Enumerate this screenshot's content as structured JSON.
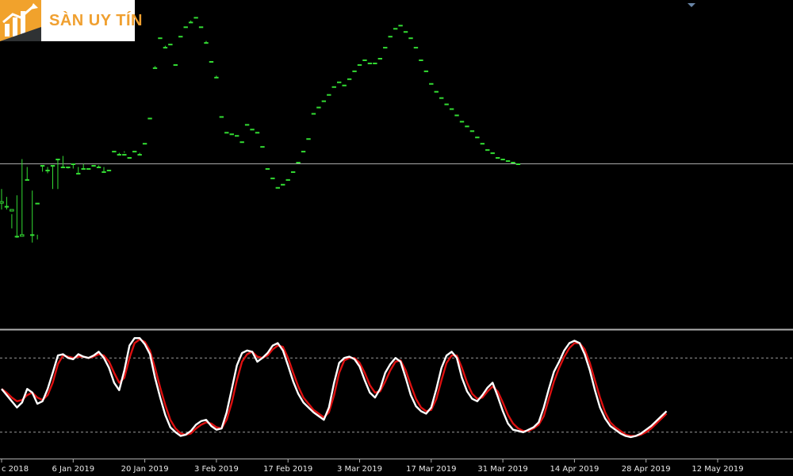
{
  "logo": {
    "brand_text": "SÀN UY TÍN"
  },
  "chart_data": [
    {
      "type": "candlestick",
      "panel": "price",
      "colors": {
        "candle": "#33dd33",
        "background": "#000000",
        "hline": "#aaaaaa"
      },
      "hline": 0.0,
      "ylim": [
        -100,
        100
      ],
      "ohlc": [
        [
          -16,
          -24,
          -25,
          -29
        ],
        [
          -21,
          -27,
          -27,
          -29
        ],
        [
          -32,
          -29,
          -30,
          -41
        ],
        [
          -20,
          -46,
          -46,
          -47
        ],
        [
          3,
          -46,
          -45,
          -46
        ],
        [
          -2,
          -10,
          -10,
          -10
        ],
        [
          -17,
          -45,
          -45,
          -50
        ],
        [
          -48,
          -25,
          -25,
          -45
        ],
        [
          -5,
          -1,
          -1,
          -1
        ],
        [
          -2,
          -4,
          -4,
          -6
        ],
        [
          -16,
          -1,
          -1,
          -1
        ],
        [
          -16,
          3,
          3,
          3
        ],
        [
          5,
          -2,
          -2,
          -2
        ],
        [
          -2,
          -2,
          -2,
          -3
        ],
        [
          -3,
          0,
          0,
          0
        ],
        [
          -2,
          -6,
          -6,
          -6
        ],
        [
          0,
          -3,
          -3,
          -3
        ],
        [
          -3,
          -3,
          -3,
          -3
        ],
        [
          -1,
          -1,
          -1,
          -1
        ],
        [
          -1,
          -2,
          -2,
          -2
        ],
        [
          -2,
          -5,
          -5,
          -5
        ],
        [
          -4,
          -4,
          -4,
          -4
        ],
        [
          8,
          8,
          8,
          8
        ],
        [
          7,
          6,
          6,
          6
        ],
        [
          8,
          6,
          6,
          7
        ],
        [
          4,
          4,
          4,
          4
        ],
        [
          8,
          8,
          8,
          8
        ],
        [
          7,
          6,
          6,
          6
        ],
        [
          13,
          13,
          13,
          13
        ],
        [
          29,
          29,
          29,
          29
        ],
        [
          62,
          61,
          61,
          61
        ],
        [
          81,
          80,
          80,
          81
        ],
        [
          75,
          74,
          74,
          74
        ],
        [
          78,
          76,
          76,
          78
        ],
        [
          64,
          63,
          63,
          64
        ],
        [
          81,
          81,
          81,
          81
        ],
        [
          87,
          87,
          87,
          87
        ],
        [
          91,
          90,
          90,
          90
        ],
        [
          93,
          93,
          93,
          93
        ],
        [
          87,
          87,
          87,
          87
        ],
        [
          78,
          77,
          77,
          77
        ],
        [
          65,
          65,
          65,
          65
        ],
        [
          56,
          55,
          55,
          55
        ],
        [
          30,
          30,
          30,
          30
        ],
        [
          20,
          20,
          20,
          20
        ],
        [
          19,
          19,
          19,
          19
        ],
        [
          18,
          18,
          18,
          18
        ],
        [
          14,
          14,
          14,
          14
        ],
        [
          25,
          25,
          25,
          25
        ],
        [
          22,
          22,
          22,
          22
        ],
        [
          20,
          20,
          20,
          20
        ],
        [
          11,
          11,
          11,
          11
        ],
        [
          -3,
          -3,
          -3,
          -3
        ],
        [
          -9,
          -9,
          -9,
          -9
        ],
        [
          -15,
          -15,
          -15,
          -15
        ],
        [
          -13,
          -13,
          -13,
          -13
        ],
        [
          -10,
          -10,
          -10,
          -10
        ],
        [
          -5,
          -5,
          -5,
          -5
        ],
        [
          1,
          1,
          1,
          1
        ],
        [
          8,
          8,
          8,
          8
        ],
        [
          16,
          16,
          16,
          16
        ],
        [
          32,
          32,
          32,
          32
        ],
        [
          36,
          36,
          36,
          36
        ],
        [
          40,
          40,
          40,
          40
        ],
        [
          44,
          44,
          44,
          44
        ],
        [
          49,
          49,
          49,
          49
        ],
        [
          52,
          52,
          52,
          52
        ],
        [
          50,
          50,
          50,
          50
        ],
        [
          54,
          54,
          54,
          54
        ],
        [
          59,
          59,
          59,
          59
        ],
        [
          63,
          63,
          63,
          63
        ],
        [
          66,
          66,
          66,
          66
        ],
        [
          64,
          64,
          64,
          64
        ],
        [
          64,
          64,
          64,
          64
        ],
        [
          67,
          67,
          67,
          67
        ],
        [
          74,
          74,
          74,
          74
        ],
        [
          81,
          81,
          81,
          81
        ],
        [
          86,
          86,
          86,
          86
        ],
        [
          88,
          88,
          88,
          88
        ],
        [
          84,
          84,
          84,
          84
        ],
        [
          80,
          80,
          80,
          80
        ],
        [
          74,
          74,
          74,
          74
        ],
        [
          66,
          66,
          66,
          66
        ],
        [
          59,
          59,
          59,
          59
        ],
        [
          51,
          51,
          51,
          51
        ],
        [
          46,
          46,
          46,
          46
        ],
        [
          42,
          42,
          42,
          42
        ],
        [
          38,
          38,
          38,
          38
        ],
        [
          35,
          35,
          35,
          35
        ],
        [
          31,
          31,
          31,
          31
        ],
        [
          27,
          27,
          27,
          27
        ],
        [
          24,
          24,
          24,
          24
        ],
        [
          21,
          21,
          21,
          21
        ],
        [
          17,
          17,
          17,
          17
        ],
        [
          13,
          13,
          13,
          13
        ],
        [
          9,
          9,
          9,
          9
        ],
        [
          7,
          7,
          7,
          7
        ],
        [
          4,
          4,
          4,
          4
        ],
        [
          3,
          3,
          3,
          3
        ],
        [
          2,
          2,
          2,
          2
        ],
        [
          1,
          1,
          1,
          1
        ],
        [
          0,
          0,
          0,
          0
        ]
      ]
    },
    {
      "type": "line",
      "panel": "oscillator",
      "ylim": [
        0,
        100
      ],
      "levels": [
        80,
        20
      ],
      "x_tick_labels": [
        "c 2018",
        "6 Jan 2019",
        "20 Jan 2019",
        "3 Feb 2019",
        "17 Feb 2019",
        "3 Mar 2019",
        "17 Mar 2019",
        "31 Mar 2019",
        "14 Apr 2019",
        "28 Apr 2019",
        "12 May 2019"
      ],
      "x_tick_positions": [
        0,
        14,
        28,
        42,
        56,
        70,
        84,
        98,
        112,
        126,
        140
      ],
      "series": [
        {
          "color": "#ffffff",
          "values": [
            55,
            50,
            45,
            40,
            44,
            55,
            52,
            43,
            45,
            55,
            68,
            82,
            83,
            80,
            79,
            83,
            81,
            80,
            82,
            85,
            80,
            72,
            60,
            54,
            70,
            90,
            96,
            96,
            91,
            83,
            64,
            48,
            34,
            24,
            20,
            17,
            18,
            21,
            26,
            29,
            30,
            25,
            22,
            23,
            36,
            55,
            74,
            84,
            86,
            85,
            77,
            80,
            84,
            90,
            92,
            86,
            74,
            61,
            51,
            44,
            40,
            36,
            33,
            30,
            40,
            60,
            76,
            80,
            81,
            79,
            73,
            62,
            52,
            48,
            55,
            68,
            75,
            80,
            77,
            64,
            50,
            41,
            37,
            35,
            40,
            55,
            72,
            82,
            85,
            80,
            64,
            53,
            47,
            45,
            50,
            56,
            60,
            49,
            37,
            27,
            22,
            21,
            20,
            22,
            24,
            28,
            40,
            55,
            69,
            77,
            86,
            92,
            94,
            92,
            83,
            70,
            54,
            40,
            31,
            25,
            22,
            19,
            17,
            16,
            17,
            19,
            22,
            25,
            29,
            33,
            37
          ]
        },
        {
          "color": "#dd1111",
          "values": [
            55,
            52,
            48,
            45,
            46,
            50,
            52,
            48,
            46,
            50,
            60,
            75,
            82,
            81,
            80,
            81,
            81,
            80,
            81,
            83,
            82,
            77,
            68,
            60,
            64,
            80,
            92,
            95,
            93,
            86,
            72,
            56,
            42,
            30,
            23,
            19,
            18,
            19,
            23,
            26,
            28,
            27,
            24,
            23,
            30,
            44,
            62,
            77,
            83,
            85,
            81,
            80,
            82,
            87,
            90,
            89,
            80,
            68,
            57,
            48,
            43,
            38,
            35,
            32,
            36,
            50,
            68,
            78,
            80,
            80,
            76,
            68,
            58,
            52,
            53,
            61,
            70,
            77,
            78,
            70,
            58,
            47,
            40,
            37,
            38,
            47,
            62,
            76,
            82,
            82,
            72,
            60,
            51,
            47,
            48,
            53,
            57,
            53,
            44,
            34,
            27,
            23,
            21,
            21,
            23,
            26,
            33,
            47,
            61,
            72,
            81,
            88,
            92,
            92,
            87,
            76,
            62,
            48,
            36,
            28,
            24,
            21,
            18,
            17,
            17,
            18,
            20,
            23,
            27,
            31,
            35
          ]
        }
      ]
    }
  ]
}
